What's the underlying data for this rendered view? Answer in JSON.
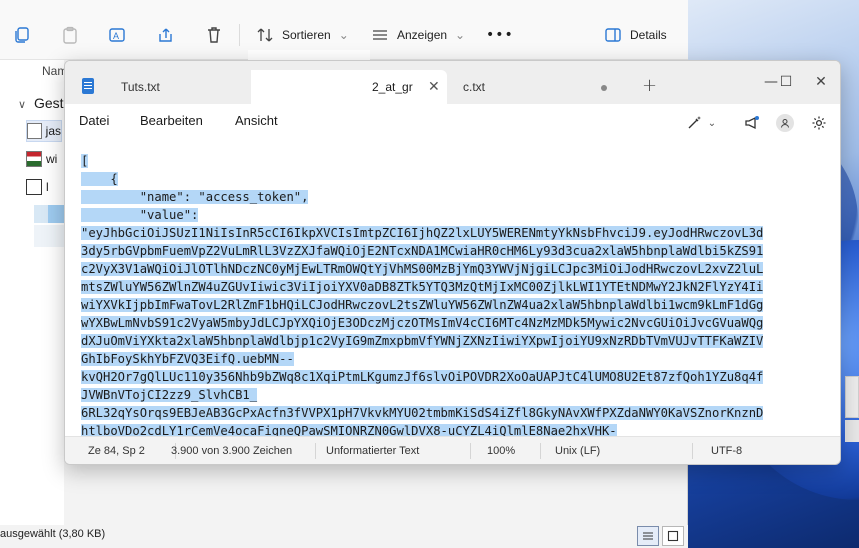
{
  "explorer": {
    "toolbar": {
      "sort_label": "Sortieren",
      "view_label": "Anzeigen",
      "more_label": "•••",
      "details_label": "Details"
    },
    "column_name_partial": "Nam",
    "section_partial": "Gest",
    "files": [
      {
        "label": "jas",
        "icon": "text-file-icon"
      },
      {
        "label": "wi",
        "icon": "archive-icon"
      },
      {
        "label": "l",
        "icon": "image-icon"
      }
    ],
    "status_text": "ausgewählt (3,80 KB)"
  },
  "notepad": {
    "tabs": [
      {
        "label": "Tuts.txt",
        "close": "✕"
      },
      {
        "label": "2_at_gr",
        "close": "✕"
      },
      {
        "label": "c.txt"
      }
    ],
    "new_tab_label": "+",
    "window_controls": {
      "minimize": "—",
      "maximize": "☐",
      "close": "✕"
    },
    "menu": {
      "file": "Datei",
      "edit": "Bearbeiten",
      "view": "Ansicht"
    },
    "content_lines": [
      "[",
      "    {",
      "        \"name\": \"access_token\",",
      "        \"value\":",
      "\"eyJhbGciOiJSUzI1NiIsInR5cCI6IkpXVCIsImtpZCI6IjhQZ2lxLUY5WERENmtyYkNsbFhvciJ9.eyJodHRwczovL3d",
      "3dy5rbGVpbmFuemVpZ2VuLmRlL3VzZXJfaWQiOjE2NTcxNDA1MCwiaHR0cHM6Ly93d3cua2xlaW5hbnplaWdlbi5kZS91",
      "c2VyX3V1aWQiOiJlOTlhNDczNC0yMjEwLTRmOWQtYjVhMS00MzBjYmQ3YWVjNjgiLCJpc3MiOiJodHRwczovL2xvZ2luL",
      "mtsZWluYW56ZWlnZW4uZGUvIiwic3ViIjoiYXV0aDB8ZTk5YTQ3MzQtMjIxMC00ZjlkLWI1YTEtNDMwY2JkN2FlYzY4Ii",
      "wiYXVkIjpbImFwaTovL2RlZmF1bHQiLCJodHRwczovL2tsZWluYW56ZWlnZW4ua2xlaW5hbnplaWdlbi1wcm9kLmF1dGg",
      "wYXBwLmNvbS91c2VyaW5mbyJdLCJpYXQiOjE3ODczMjczOTMsImV4cCI6MTc4NzMzMDk5Mywic2NvcGUiOiJvcGVuaWQg",
      "dXJuOmViYXkta2xlaW5hbnplaWdlbjp1c2VyIG9mZmxpbmVfYWNjZXNzIiwiYXpwIjoiYU9xNzRDbTVmVUJvTTFKaWZIV",
      "GhIbFoySkhYbFZVQ3EifQ.uebMN--",
      "kvQH2Or7gQlLUc110y356Nhb9bZWq8c1XqiPtmLKgumzJf6slvOiPOVDR2XoOaUAPJtC4lUMO8U2Et87zfQoh1YZu8q4f",
      "JVWBnVTojCI2zz9_SlvhCB1_",
      "6RL32qYsOrqs9EBJeAB3GcPxAcfn3fVVPX1pH7VkvkMYU02tmbmKiSdS4iZfl8GkyNAvXWfPXZdaNWY0KaVSZnorKnznD",
      "htlboVDo2cdLY1rCemVe4ocaFigneQPawSMIONRZN0GwlDVX8-uCYZL4iQlmlE8Nae2hxVHK-"
    ],
    "status": {
      "position": "Ze 84, Sp 2",
      "chars": "3.900 von 3.900 Zeichen",
      "format": "Unformatierter Text",
      "zoom": "100%",
      "line_ending": "Unix (LF)",
      "encoding": "UTF-8"
    }
  },
  "colors": {
    "selection": "#b4d7f7",
    "accent": "#2b78d4",
    "desktop": "#1f4fb8"
  }
}
